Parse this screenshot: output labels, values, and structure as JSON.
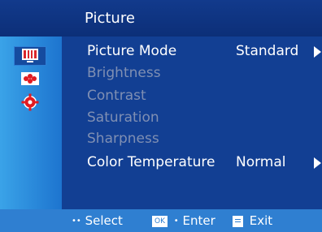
{
  "menu": {
    "title": "Picture",
    "icons": [
      "picture-icon",
      "color-settings-icon",
      "gear-icon"
    ],
    "items": [
      {
        "label": "Picture Mode",
        "value": "Standard",
        "enabled": true,
        "has_arrow": true
      },
      {
        "label": "Brightness",
        "value": "",
        "enabled": false,
        "has_arrow": false
      },
      {
        "label": "Contrast",
        "value": "",
        "enabled": false,
        "has_arrow": false
      },
      {
        "label": "Saturation",
        "value": "",
        "enabled": false,
        "has_arrow": false
      },
      {
        "label": "Sharpness",
        "value": "",
        "enabled": false,
        "has_arrow": false
      },
      {
        "label": "Color Temperature",
        "value": "Normal",
        "enabled": true,
        "has_arrow": true
      }
    ]
  },
  "footer": {
    "select_label": "Select",
    "ok_key": "OK",
    "enter_label": "Enter",
    "exit_label": "Exit"
  },
  "colors": {
    "title_bar": "#123a8c",
    "main_panel": "#123f93",
    "sidebar": "#2f8de0",
    "footer": "#2f7fd1",
    "disabled_text": "#7f8fb3"
  }
}
